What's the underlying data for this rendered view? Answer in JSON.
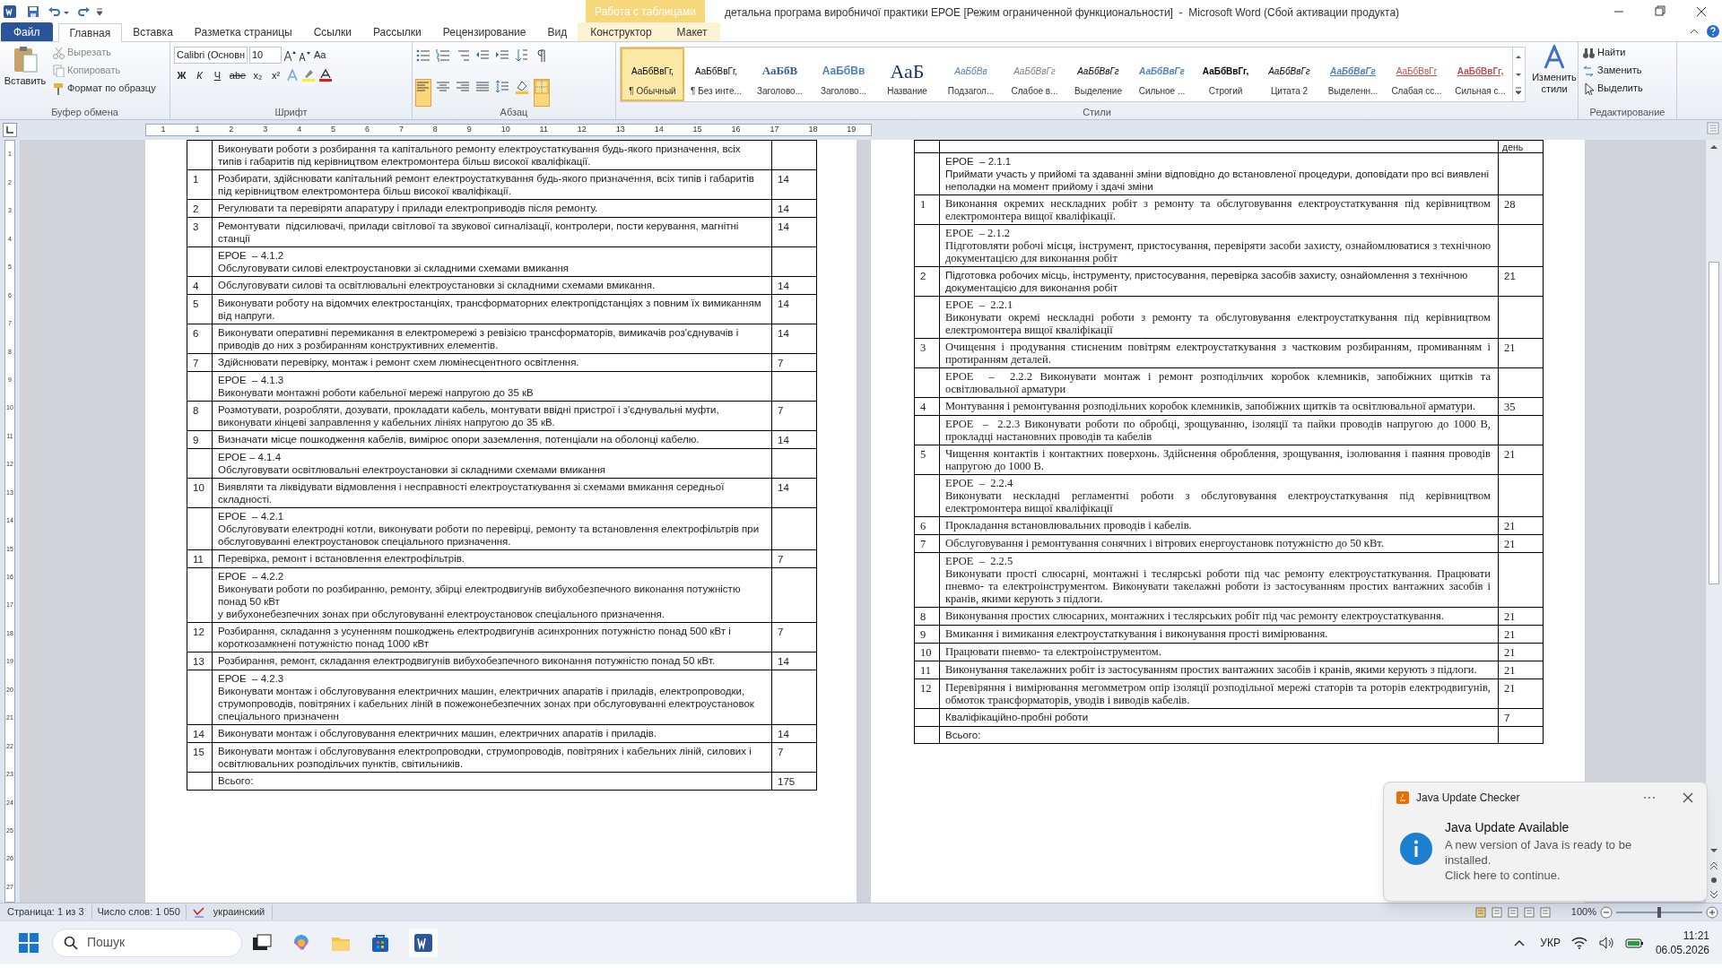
{
  "window": {
    "title": "детальна програма виробничої практики ЕРОЕ [Режим ограниченной функциональности]  -  Microsoft Word (Сбой активации продукта)",
    "context_group": "Работа с таблицами"
  },
  "ribbon_tabs": [
    {
      "label": "Файл",
      "kind": "file",
      "selected": false
    },
    {
      "label": "Главная",
      "kind": "normal",
      "selected": true
    },
    {
      "label": "Вставка",
      "kind": "normal",
      "selected": false
    },
    {
      "label": "Разметка страницы",
      "kind": "normal",
      "selected": false
    },
    {
      "label": "Ссылки",
      "kind": "normal",
      "selected": false
    },
    {
      "label": "Рассылки",
      "kind": "normal",
      "selected": false
    },
    {
      "label": "Рецензирование",
      "kind": "normal",
      "selected": false
    },
    {
      "label": "Вид",
      "kind": "normal",
      "selected": false
    },
    {
      "label": "Конструктор",
      "kind": "context",
      "selected": false
    },
    {
      "label": "Макет",
      "kind": "context",
      "selected": false
    }
  ],
  "clipboard": {
    "paste": "Вставить",
    "cut": "Вырезать",
    "copy": "Копировать",
    "format_painter": "Формат по образцу",
    "label": "Буфер обмена"
  },
  "font": {
    "name": "Calibri (Основн",
    "size": "10",
    "case_button": "Aa",
    "buttons": [
      "Ж",
      "К",
      "Ч",
      "abe",
      "x₂",
      "x²"
    ],
    "label": "Шрифт"
  },
  "paragraph": {
    "label": "Абзац"
  },
  "styles": {
    "label": "Стили",
    "change": "Изменить стили",
    "items": [
      {
        "preview": "АаБбВвГг,",
        "name": "¶ Обычный",
        "kind": "normal",
        "selected": true
      },
      {
        "preview": "АаБбВвГг,",
        "name": "¶ Без инте...",
        "kind": "normal",
        "selected": false
      },
      {
        "preview": "АаБбВ",
        "name": "Заголово...",
        "kind": "heading1",
        "selected": false
      },
      {
        "preview": "АаБбВв",
        "name": "Заголово...",
        "kind": "heading2",
        "selected": false
      },
      {
        "preview": "АаБ",
        "name": "Название",
        "kind": "title",
        "selected": false
      },
      {
        "preview": "АаБбВв",
        "name": "Подзагол...",
        "kind": "subtitle",
        "selected": false
      },
      {
        "preview": "АаБбВвГг",
        "name": "Слабое в...",
        "kind": "subtle",
        "selected": false
      },
      {
        "preview": "АаБбВвГг",
        "name": "Выделение",
        "kind": "emphasis",
        "selected": false
      },
      {
        "preview": "АаБбВвГг",
        "name": "Сильное ...",
        "kind": "intense",
        "selected": false
      },
      {
        "preview": "АаБбВвГг,",
        "name": "Строгий",
        "kind": "strong",
        "selected": false
      },
      {
        "preview": "АаБбВвГг",
        "name": "Цитата 2",
        "kind": "quote",
        "selected": false
      },
      {
        "preview": "АаБбВвГг",
        "name": "Выделенн...",
        "kind": "intense_quote",
        "selected": false
      },
      {
        "preview": "АаБбВвГг",
        "name": "Слабая сс...",
        "kind": "subtle_ref",
        "selected": false
      },
      {
        "preview": "АаБбВвГг,",
        "name": "Сильная с...",
        "kind": "intense_ref",
        "selected": false
      }
    ]
  },
  "editing": {
    "label": "Редактирование",
    "find": "Найти",
    "replace": "Заменить",
    "select": "Выделить"
  },
  "ruler": {
    "labels": [
      "1",
      "1",
      "2",
      "3",
      "4",
      "5",
      "6",
      "7",
      "8",
      "9",
      "10",
      "11",
      "12",
      "13",
      "14",
      "15",
      "16",
      "17",
      "18",
      "19"
    ]
  },
  "vertical_ruler": {
    "labels": [
      "1",
      "2",
      "3",
      "4",
      "5",
      "6",
      "7",
      "8",
      "9",
      "10",
      "11",
      "12",
      "13",
      "14",
      "15",
      "16",
      "17",
      "18",
      "19",
      "20",
      "21",
      "22",
      "23",
      "24",
      "25",
      "26",
      "27"
    ]
  },
  "pages": [
    {
      "rows": [
        {
          "lines": [
            "Виконувати роботи з розбирання та капітального ремонту електроустаткування будь-якого призначення, всіх типів і габаритів під керівництвом електромонтера більш високої кваліфікації."
          ]
        },
        {
          "num": "1",
          "lines": [
            "Розбирати, здійснювати капітальний ремонт електроустаткування будь-якого призначення, всіх типів і габаритів під керівництвом електромонтера більш високої кваліфікації."
          ],
          "days": "14"
        },
        {
          "num": "2",
          "lines": [
            "Регулювати та перевіряти апаратуру і прилади електроприводів після ремонту."
          ],
          "days": "14"
        },
        {
          "num": "3",
          "lines": [
            "Ремонтувати  підсилювачі, прилади світлової та звукової сигналізації, контролери, пости керування, магнітні станції"
          ],
          "days": "14"
        },
        {
          "lines": [
            "ЕРОЕ  – 4.1.2",
            "Обслуговувати силові електроустановки зі складними схемами вмикання"
          ]
        },
        {
          "num": "4",
          "lines": [
            "Обслуговувати силові та освітлювальні електроустановки зі складними схемами вмикання."
          ],
          "days": "14"
        },
        {
          "num": "5",
          "lines": [
            "Виконувати роботу на відомчих електростанціях, трансформаторних електропідстанціях з повним їх вимиканням від напруги."
          ],
          "days": "14"
        },
        {
          "num": "6",
          "lines": [
            "Виконувати оперативні перемикання в електромережі з ревізією трансформаторів, вимикачів роз'єднувачів і приводів до них з розбиранням конструктивних елементів."
          ],
          "days": "14"
        },
        {
          "num": "7",
          "lines": [
            "Здійснювати перевірку, монтаж і ремонт схем люмінесцентного освітлення."
          ],
          "days": "7"
        },
        {
          "lines": [
            "ЕРОЕ  – 4.1.3",
            "Виконувати монтажні роботи кабельної мережі напругою до 35 кВ"
          ]
        },
        {
          "num": "8",
          "lines": [
            "Розмотувати, розробляти, дозувати, прокладати кабель, монтувати ввідні пристрої і з'єднувальні муфти, виконувати кінцеві заправлення у кабельних лініях напругою до 35 кВ."
          ],
          "days": "7"
        },
        {
          "num": "9",
          "lines": [
            "Визначати місце пошкодження кабелів, вимірює опори заземлення, потенціали на оболонці кабелю."
          ],
          "days": "14"
        },
        {
          "lines": [
            "ЕРОЕ – 4.1.4",
            "Обслуговувати освітлювальні електроустановки зі складними схемами вмикання"
          ]
        },
        {
          "num": "10",
          "lines": [
            "Виявляти та ліквідувати відмовлення і несправності електроустаткування зі схемами вмикання середньої складності."
          ],
          "days": "14"
        },
        {
          "lines": [
            "ЕРОЕ  – 4.2.1",
            "Обслуговувати електродні котли, виконувати роботи по перевірці, ремонту та встановлення електрофільтрів при обслуговуванні електроустановок спеціального призначення."
          ]
        },
        {
          "num": "11",
          "lines": [
            "Перевірка, ремонт і встановлення електрофільтрів."
          ],
          "days": "7"
        },
        {
          "lines": [
            "ЕРОЕ  – 4.2.2",
            "Виконувати роботи по розбиранню, ремонту, збірці електродвигунів вибухобезпечного виконання потужністю понад 50 кВт",
            "у вибухонебезпечних зонах при обслуговуванні електроустановок спеціального призначення."
          ]
        },
        {
          "num": "12",
          "lines": [
            "Розбирання, складання з усуненням пошкоджень електродвигунів асинхронних потужністю понад 500 кВт і короткозамкнені потужністю понад 1000 кВт"
          ],
          "days": "7"
        },
        {
          "num": "13",
          "lines": [
            "Розбирання, ремонт, складання електродвигунів вибухобезпечного виконання потужністю понад 50 кВт."
          ],
          "days": "14"
        },
        {
          "lines": [
            "ЕРОЕ  – 4.2.3",
            "Виконувати монтаж і обслуговування електричних машин, електричних апаратів і приладів, електропроводки, струмопроводів, повітряних і кабельних ліній в пожежонебезпечних зонах при обслуговуванні електроустановок спеціального призначенн"
          ]
        },
        {
          "num": "14",
          "lines": [
            "Виконувати монтаж і обслуговування електричних машин, електричних апаратів і приладів."
          ],
          "days": "14"
        },
        {
          "num": "15",
          "lines": [
            "Виконувати монтаж і обслуговування електропроводки, струмопроводів, повітряних і кабельних ліній, силових і освітлювальних розподільчих пунктів, світильників."
          ],
          "days": "7"
        },
        {
          "lines": [
            "Всього:"
          ],
          "days": "175"
        }
      ]
    },
    {
      "header_days": "день",
      "rows": [
        {
          "lines": [
            "ЕРОЕ  – 2.1.1",
            "Приймати участь у прийомі та здаванні зміни відповідно до встановленої процедури, доповідати про всі виявлені неполадки на момент прийому і здачі зміни"
          ]
        },
        {
          "num": "1",
          "serif": true,
          "lines": [
            "Виконання окремих нескладних робіт з ремонту та обслуговування електроустаткування під керівництвом електромонтера вищої кваліфікації."
          ],
          "days": "28"
        },
        {
          "serif": true,
          "lines": [
            "ЕРОЕ  – 2.1.2",
            "Підготовляти робочі місця, інструмент, пристосування, перевіряти засоби захисту, ознайомлюватися з технічною документацією для виконання робіт"
          ]
        },
        {
          "num": "2",
          "lines": [
            "Підготовка робочих місць, інструменту, пристосування, перевірка засобів захисту, ознайомлення з технічною документацією для виконання робіт"
          ],
          "days": "21"
        },
        {
          "serif": true,
          "lines": [
            "ЕРОЕ  –  2.2.1",
            "Виконувати окремі нескладні роботи з ремонту та обслуговування електроустаткування під керівництвом електромонтера вищої кваліфікації"
          ]
        },
        {
          "num": "3",
          "serif": true,
          "lines": [
            "Очищення і продування стисненим повітрям електроустаткування з частковим розбиранням, промиванням і протиранням деталей."
          ],
          "days": "21"
        },
        {
          "serif": true,
          "lines": [
            "ЕРОЕ  –  2.2.2 Виконувати монтаж і ремонт розподільчих коробок клемників, запобіжних щитків та освітлювальної арматури"
          ]
        },
        {
          "num": "4",
          "serif": true,
          "lines": [
            "Монтування і ремонтування розподільних коробок клемників, запобіжних щитків та освітлювальної арматури."
          ],
          "days": "35"
        },
        {
          "serif": true,
          "lines": [
            "ЕРОЕ  –  2.2.3 Виконувати роботи по обробці, зрощуванню, ізоляції та пайки проводів напругою до 1000 В, прокладці настановних проводів та кабелів"
          ]
        },
        {
          "num": "5",
          "serif": true,
          "lines": [
            "Чищення контактів і контактних поверхонь. Здійснення оброблення, зрощування, ізолювання і паяння проводів напругою до 1000 В."
          ],
          "days": "21"
        },
        {
          "serif": true,
          "lines": [
            "ЕРОЕ  –  2.2.4",
            "Виконувати нескладні регламентні роботи з обслуговування електроустаткування під керівництвом електромонтера вищої кваліфікації"
          ]
        },
        {
          "num": "6",
          "serif": true,
          "lines": [
            "Прокладання встановлювальних проводів і кабелів."
          ],
          "days": "21"
        },
        {
          "num": "7",
          "serif": true,
          "lines": [
            "Обслуговування і ремонтування сонячних і вітрових енергоустановк потужністю до 50 кВт."
          ],
          "days": "21"
        },
        {
          "serif": true,
          "lines": [
            "ЕРОЕ  –  2.2.5",
            "Виконувати прості слюсарні, монтажні і теслярські роботи під час ремонту електроустаткування. Працювати пневмо- та електроінструментом. Виконувати такелажні роботи із застосуванням простих вантажних засобів і кранів, якими керують з підлоги."
          ]
        },
        {
          "num": "8",
          "serif": true,
          "lines": [
            "Виконування простих слюсарних, монтажних і теслярських робіт під час ремонту електроустаткування."
          ],
          "days": "21"
        },
        {
          "num": "9",
          "serif": true,
          "lines": [
            "Вмикання і вимикання електроустаткування і виконування прості вимірювання."
          ],
          "days": "21"
        },
        {
          "num": "10",
          "serif": true,
          "lines": [
            "Працювати пневмо- та електроінструментом."
          ],
          "days": "21"
        },
        {
          "num": "11",
          "serif": true,
          "lines": [
            "Виконування такелажних робіт із застосуванням простих вантажних засобів і кранів, якими керують з підлоги."
          ],
          "days": "21"
        },
        {
          "num": "12",
          "serif": true,
          "lines": [
            "Перевіряння і вимірювання мегомметром опір ізоляції розподільної мережі статорів та роторів електродвигунів, обмоток трансформаторів, уводів і виводів кабелів."
          ],
          "days": "21"
        },
        {
          "lines": [
            "Кваліфікаційно-пробні роботи"
          ],
          "days": "7"
        },
        {
          "lines": [
            "Всього:"
          ]
        }
      ]
    }
  ],
  "status_bar": {
    "page": "Страница: 1 из 3",
    "words": "Число слов: 1 050",
    "language": "украинский",
    "zoom": "100%",
    "level": 0.5
  },
  "notification": {
    "app": "Java Update Checker",
    "heading": "Java Update Available",
    "body": "A new version of Java is ready to be installed.",
    "link": "Click here to continue."
  },
  "taskbar": {
    "search": "Пошук",
    "language": "УКР",
    "time": "11:21",
    "date": "06.05.2026"
  }
}
